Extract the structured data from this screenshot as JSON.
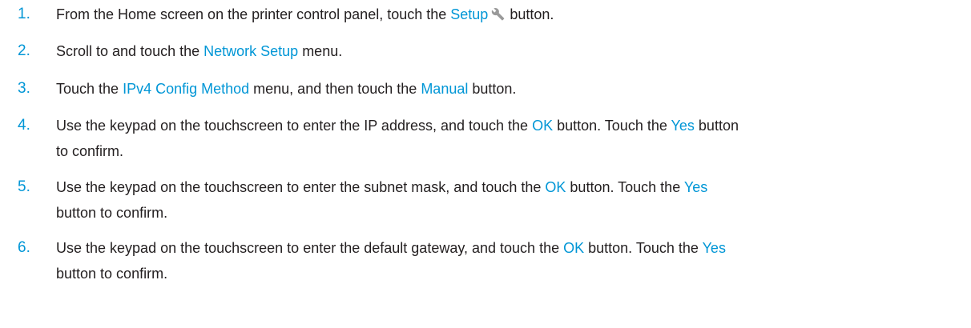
{
  "steps": [
    {
      "number": "1.",
      "parts": [
        "From the Home screen on the printer control panel, touch the ",
        "Setup",
        "button."
      ],
      "icon": "wrench-icon"
    },
    {
      "number": "2.",
      "parts": [
        "Scroll to and touch the ",
        "Network Setup",
        " menu."
      ]
    },
    {
      "number": "3.",
      "parts": [
        "Touch the ",
        "IPv4 Config Method",
        " menu, and then touch the ",
        "Manual",
        " button."
      ]
    },
    {
      "number": "4.",
      "line1_parts": [
        "Use the keypad on the touchscreen to enter the IP address, and touch the ",
        "OK",
        " button. Touch the ",
        "Yes",
        " button"
      ],
      "line2": "to confirm."
    },
    {
      "number": "5.",
      "line1_parts": [
        "Use the keypad on the touchscreen to enter the subnet mask, and touch the ",
        "OK",
        " button. Touch the ",
        "Yes"
      ],
      "line2": "button to confirm."
    },
    {
      "number": "6.",
      "line1_parts": [
        "Use the keypad on the touchscreen to enter the default gateway, and touch the ",
        "OK",
        " button. Touch the ",
        "Yes"
      ],
      "line2": "button to confirm."
    }
  ],
  "colors": {
    "accent": "#0096d6",
    "text": "#231f20",
    "background": "#ffffff"
  }
}
